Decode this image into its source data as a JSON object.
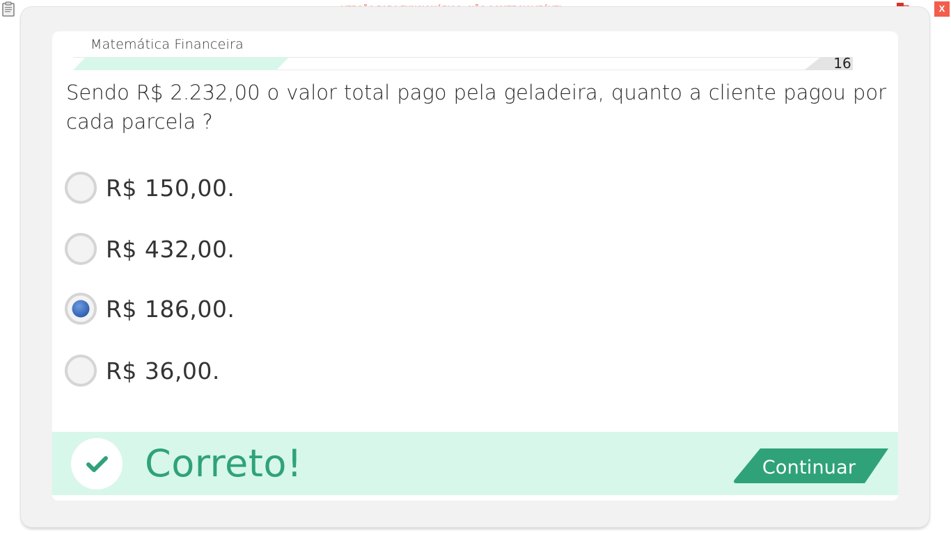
{
  "app_bar": {
    "watermark": "VERSÃO PARA FUNCIONÁRIOS - NÃO COMERCIALIZÁVEL",
    "close_label": "X"
  },
  "header": {
    "subject": "Matemática Financeira",
    "question_number": "16"
  },
  "question": {
    "text": "Sendo R$ 2.232,00 o valor total pago pela geladeira, quanto a cliente pagou por cada parcela ?"
  },
  "options": [
    {
      "label": "R$ 150,00.",
      "selected": false
    },
    {
      "label": "R$ 432,00.",
      "selected": false
    },
    {
      "label": "R$ 186,00.",
      "selected": true
    },
    {
      "label": "R$ 36,00.",
      "selected": false
    }
  ],
  "feedback": {
    "status": "Correto!",
    "continue_label": "Continuar"
  },
  "colors": {
    "accent_green": "#2fa27a",
    "feedback_bg": "#d7f7ea",
    "selected_radio": "#3f73c4",
    "watermark_red": "#f26a5b"
  },
  "icons": {
    "app_icon": "clipboard-icon",
    "status_icon": "network-icon",
    "feedback_icon": "checkmark-icon"
  }
}
